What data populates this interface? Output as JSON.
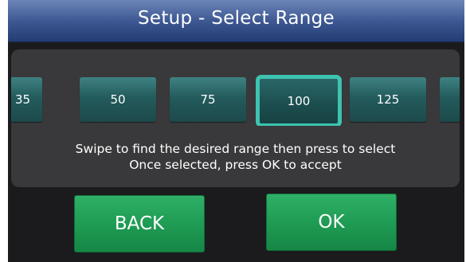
{
  "header": {
    "title": "Setup - Select Range"
  },
  "range_selector": {
    "options": [
      "35",
      "50",
      "75",
      "100",
      "125"
    ],
    "selected": "100"
  },
  "instructions": {
    "line1": "Swipe to find the desired range then press to select",
    "line2": "Once selected, press OK to accept"
  },
  "buttons": {
    "back_label": "BACK",
    "ok_label": "OK"
  },
  "colors": {
    "title_bar": "#3e5993",
    "panel": "#39393b",
    "tile": "#235b5c",
    "selected_border": "#3ec3b0",
    "button": "#1e9a52"
  }
}
